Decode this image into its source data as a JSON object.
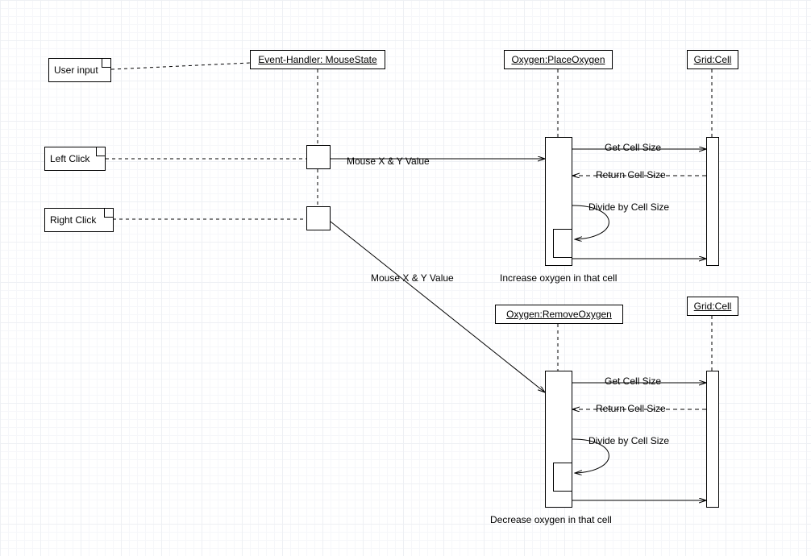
{
  "notes": {
    "user_input": "User input",
    "left_click": "Left Click",
    "right_click": "Right Click"
  },
  "participants": {
    "event_handler": "Event-Handler: MouseState",
    "place_oxygen": "Oxygen:PlaceOxygen",
    "remove_oxygen": "Oxygen:RemoveOxygen",
    "grid_cell_top": "Grid:Cell",
    "grid_cell_bottom": "Grid:Cell"
  },
  "messages": {
    "mouse_xy_1": "Mouse X & Y Value",
    "mouse_xy_2": "Mouse X & Y Value",
    "get_cell_size_1": "Get Cell Size",
    "return_cell_size_1": "Return Cell Size",
    "divide_1": "Divide by Cell Size",
    "increase": "Increase oxygen in that cell",
    "get_cell_size_2": "Get Cell Size",
    "return_cell_size_2": "Return Cell Size",
    "divide_2": "Divide by Cell Size",
    "decrease": "Decrease oxygen in that cell"
  }
}
